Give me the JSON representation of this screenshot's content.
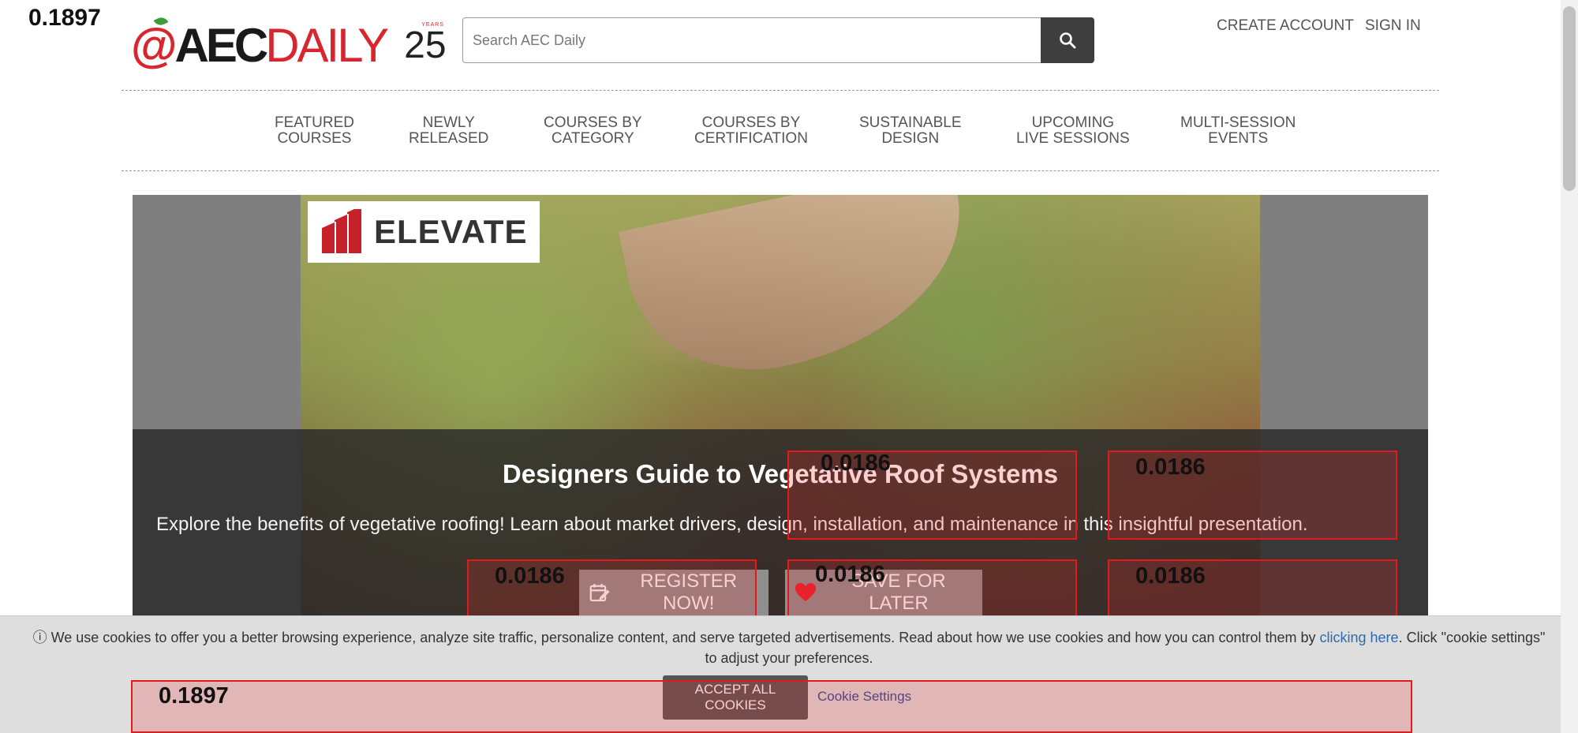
{
  "scores": {
    "top_left": "0.1897",
    "bottom_left": "0.1897",
    "box_a": "0.0186",
    "box_b": "0.0186",
    "box_c": "0.0186",
    "box_d": "0.0186",
    "box_e": "0.0186",
    "box_f": "0.0186"
  },
  "brand": {
    "at": "@",
    "aec": "AEC",
    "daily": "DAILY",
    "anniversary": "25",
    "years": "YEARS",
    "colors": {
      "red": "#d8262f",
      "dark": "#1a1a1a",
      "leaf": "#3f9a3a"
    }
  },
  "search": {
    "placeholder": "Search AEC Daily",
    "icon": "search-icon"
  },
  "header_links": {
    "create_account": "CREATE ACCOUNT",
    "sign_in": "SIGN IN"
  },
  "nav": [
    {
      "line1": "FEATURED",
      "line2": "COURSES"
    },
    {
      "line1": "NEWLY",
      "line2": "RELEASED"
    },
    {
      "line1": "COURSES BY",
      "line2": "CATEGORY"
    },
    {
      "line1": "COURSES BY",
      "line2": "CERTIFICATION"
    },
    {
      "line1": "SUSTAINABLE",
      "line2": "DESIGN"
    },
    {
      "line1": "UPCOMING",
      "line2": "LIVE SESSIONS"
    },
    {
      "line1": "MULTI-SESSION",
      "line2": "EVENTS"
    }
  ],
  "hero": {
    "sponsor": "ELEVATE",
    "title": "Designers Guide to Vegetative Roof Systems",
    "description": "Explore the benefits of vegetative roofing! Learn about market drivers, design, installation, and maintenance in this insightful presentation.",
    "register_label": "REGISTER NOW!",
    "save_label": "SAVE FOR LATER"
  },
  "cookie": {
    "icon": "info-icon",
    "text_before": "We use cookies to offer you a better browsing experience, analyze site traffic, personalize content, and serve targeted advertisements. Read about how we use cookies and how you can control them by ",
    "link_text": "clicking here",
    "text_after": ". Click \"cookie settings\" to adjust your preferences.",
    "accept_label": "ACCEPT ALL COOKIES",
    "settings_label": "Cookie Settings"
  }
}
